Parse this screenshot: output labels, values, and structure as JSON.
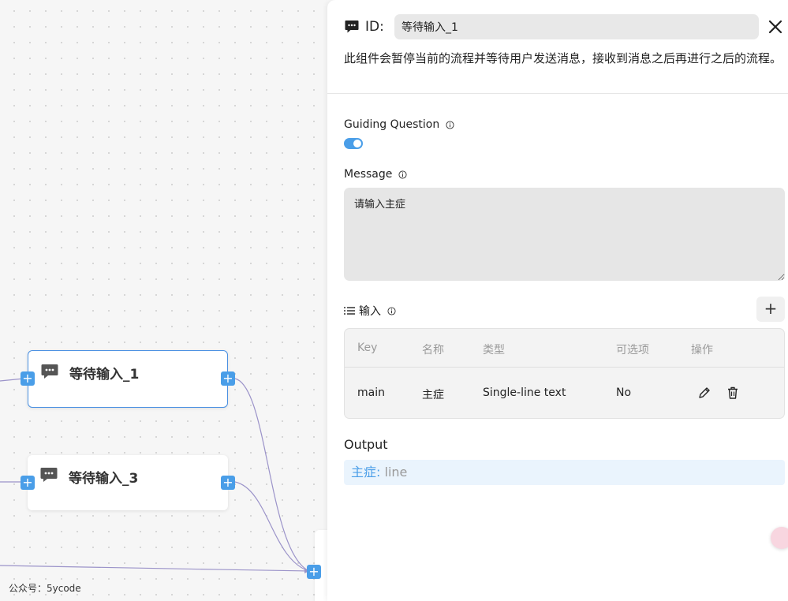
{
  "canvas": {
    "nodes": [
      {
        "title": "等待输入_1",
        "icon": "chat-bubble-icon",
        "selected": true
      },
      {
        "title": "等待输入_3",
        "icon": "chat-bubble-icon",
        "selected": false
      }
    ],
    "handle_glyph": "+",
    "watermark": "公众号：5ycode"
  },
  "panel": {
    "header": {
      "icon": "chat-bubble-icon",
      "id_label": "ID:",
      "id_value": "等待输入_1",
      "close_icon": "close-icon"
    },
    "description": "此组件会暂停当前的流程并等待用户发送消息，接收到消息之后再进行之后的流程。",
    "guiding_question": {
      "label": "Guiding Question",
      "enabled": true
    },
    "message": {
      "label": "Message",
      "value": "请输入主症"
    },
    "inputs": {
      "label": "输入",
      "add_glyph": "+",
      "columns": [
        "Key",
        "名称",
        "类型",
        "可选项",
        "操作"
      ],
      "rows": [
        {
          "key": "main",
          "name": "主症",
          "type": "Single-line text",
          "optional": "No"
        }
      ]
    },
    "output": {
      "label": "Output",
      "key": "主症:",
      "value": "line"
    },
    "colors": {
      "accent": "#4a9ee8",
      "selected_border": "#4a90e2"
    }
  }
}
